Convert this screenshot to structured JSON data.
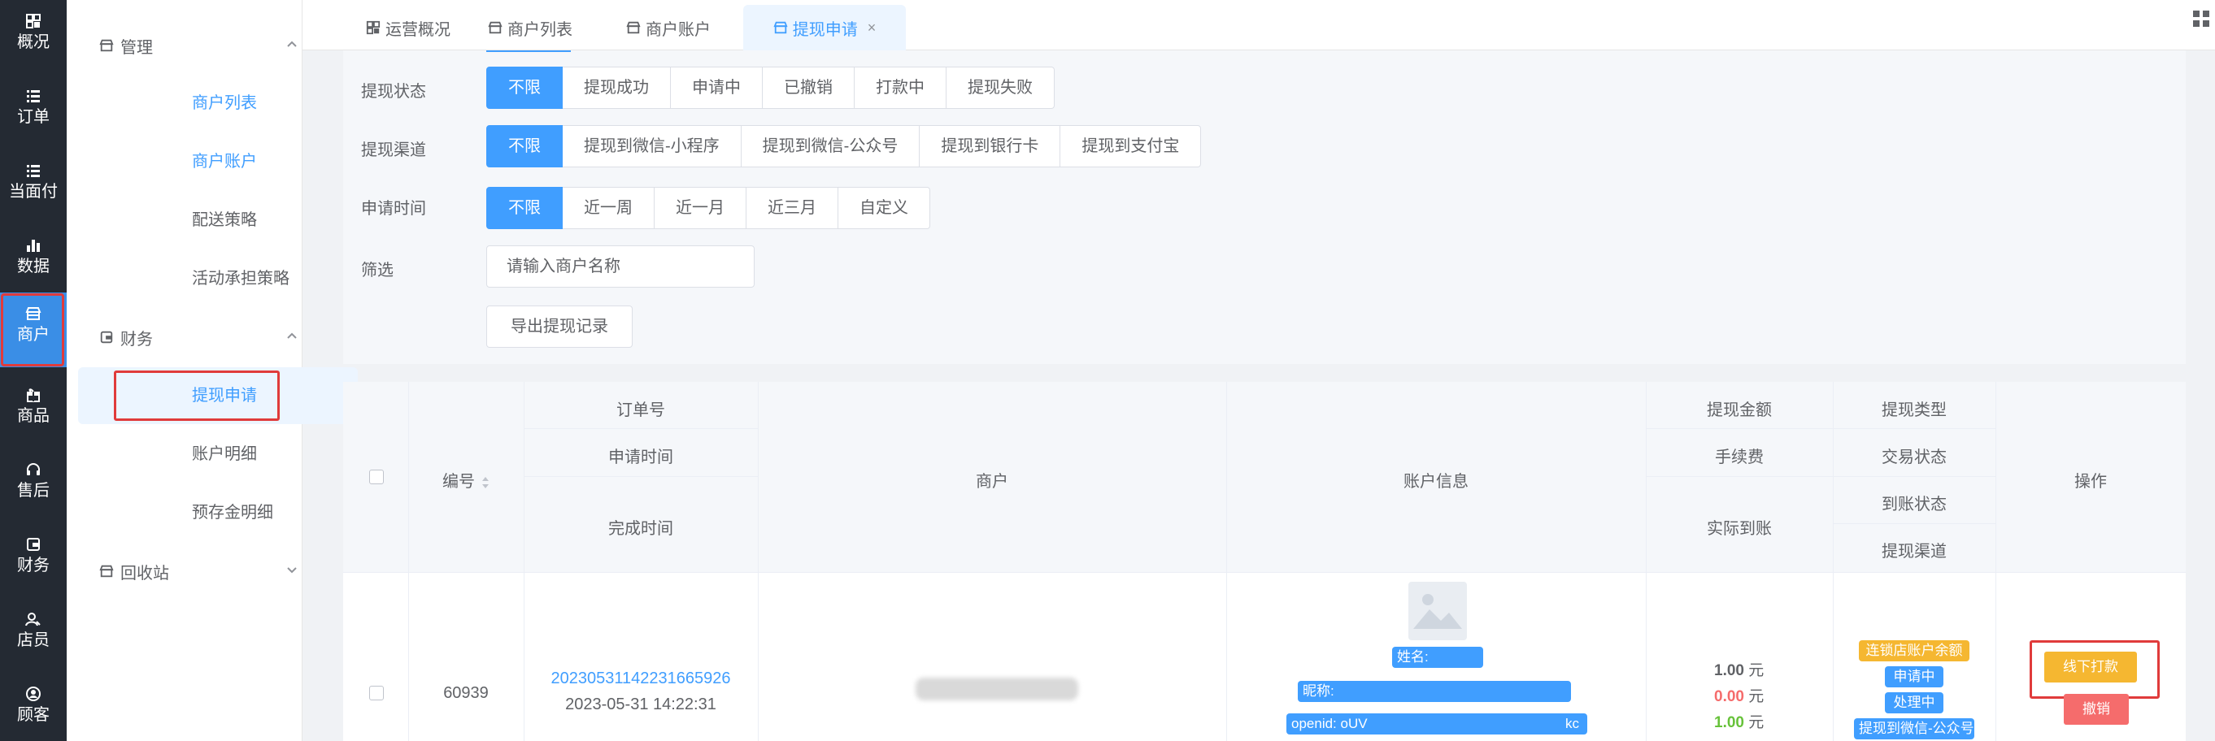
{
  "rail": {
    "items": [
      {
        "label": "概况",
        "icon": "dashboard-icon"
      },
      {
        "label": "订单",
        "icon": "list-icon"
      },
      {
        "label": "当面付",
        "icon": "list-icon"
      },
      {
        "label": "数据",
        "icon": "bar-chart-icon"
      },
      {
        "label": "商户",
        "icon": "store-icon"
      },
      {
        "label": "商品",
        "icon": "gift-icon"
      },
      {
        "label": "售后",
        "icon": "headset-icon"
      },
      {
        "label": "财务",
        "icon": "wallet-icon"
      },
      {
        "label": "店员",
        "icon": "users-icon"
      },
      {
        "label": "顾客",
        "icon": "user-circle-icon"
      }
    ]
  },
  "submenu": {
    "group_manage": "管理",
    "items_manage": [
      "商户列表",
      "商户账户",
      "配送策略",
      "活动承担策略"
    ],
    "group_finance": "财务",
    "items_finance": [
      "提现申请",
      "账户明细",
      "预存金明细"
    ],
    "group_recycle": "回收站"
  },
  "tabs": [
    {
      "label": "运营概况"
    },
    {
      "label": "商户列表"
    },
    {
      "label": "商户账户"
    },
    {
      "label": "提现申请",
      "close": "×"
    }
  ],
  "filters": {
    "status": {
      "label": "提现状态",
      "options": [
        "不限",
        "提现成功",
        "申请中",
        "已撤销",
        "打款中",
        "提现失败"
      ]
    },
    "channel": {
      "label": "提现渠道",
      "options": [
        "不限",
        "提现到微信-小程序",
        "提现到微信-公众号",
        "提现到银行卡",
        "提现到支付宝"
      ]
    },
    "time": {
      "label": "申请时间",
      "options": [
        "不限",
        "近一周",
        "近一月",
        "近三月",
        "自定义"
      ]
    },
    "search": {
      "label": "筛选",
      "placeholder": "请输入商户名称"
    },
    "export_label": "导出提现记录"
  },
  "table": {
    "headers": {
      "id": "编号",
      "order_no": "订单号",
      "apply_time": "申请时间",
      "finish_time": "完成时间",
      "merchant": "商户",
      "account_info": "账户信息",
      "amount": "提现金额",
      "fee": "手续费",
      "actual": "实际到账",
      "type": "提现类型",
      "trade_status": "交易状态",
      "arrival_status": "到账状态",
      "channel": "提现渠道",
      "operation": "操作"
    },
    "row": {
      "id": "60939",
      "order_no": "20230531142231665926",
      "apply_time": "2023-05-31 14:22:31",
      "name_prefix": "姓名:",
      "nickname_prefix": "昵称:",
      "openid_prefix": "openid: oUV",
      "openid_suffix": "kc",
      "amount": "1.00",
      "fee": "0.00",
      "actual": "1.00",
      "currency": "元",
      "tag_type": "连锁店账户余额",
      "tag_trade": "申请中",
      "tag_arrival": "处理中",
      "tag_channel": "提现到微信-公众号",
      "btn_offline": "线下打款",
      "btn_cancel": "撤销"
    }
  },
  "colors": {
    "primary": "#409eff",
    "rail_bg": "#242a33",
    "highlight": "#e03b3b",
    "warning": "#f5b731",
    "danger": "#f56c6c",
    "success": "#67c23a"
  }
}
